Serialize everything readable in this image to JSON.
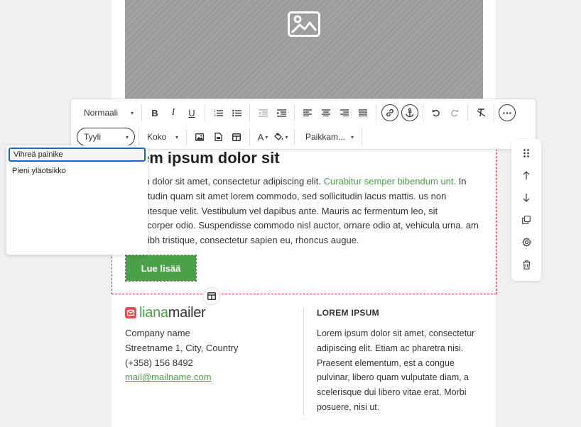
{
  "toolbar": {
    "paragraph_format": "Normaali",
    "style_select": "Tyyli",
    "font_size": "Koko",
    "placeholder_select": "Paikkam..."
  },
  "style_menu": {
    "items": [
      "Vihreä painike",
      "Pieni yläotsikko"
    ]
  },
  "content": {
    "title": "orem ipsum dolor sit",
    "paragraph": {
      "part1": " ipsum dolor sit amet, consectetur adipiscing elit. ",
      "green": "Curabitur semper bibendum unt.",
      "part2": " In sollicitudin quam sit amet lorem commodo, sed sollicitudin lacus mattis. us non pellentesque velit. Vestibulum vel dapibus ante. Mauris ac fermentum leo, sit ullamcorper odio. Suspendisse commodo nisl auctor, ornare odio at, vehicula urna. am nec nibh tristique, consectetur sapien eu, rhoncus augue."
    },
    "button_label": "Lue lisää"
  },
  "footer": {
    "logo_part1": "liana",
    "logo_part2": "mailer",
    "company": "Company name",
    "street": "Streetname 1, City, Country",
    "phone": "(+358) 156 8492",
    "email": "mail@mailname.com",
    "right_heading": "LOREM IPSUM",
    "right_body": "Lorem ipsum dolor sit amet, consectetur adipiscing elit. Etiam ac pharetra nisi. Praesent elementum, est a congue pulvinar, libero quam vulputate diam, a scelerisque dui libero vitae erat. Morbi posuere, nisi ut."
  },
  "colors": {
    "accent_green": "#4ba147",
    "selection_red": "#d0232b",
    "focus_blue": "#1f66b6"
  }
}
